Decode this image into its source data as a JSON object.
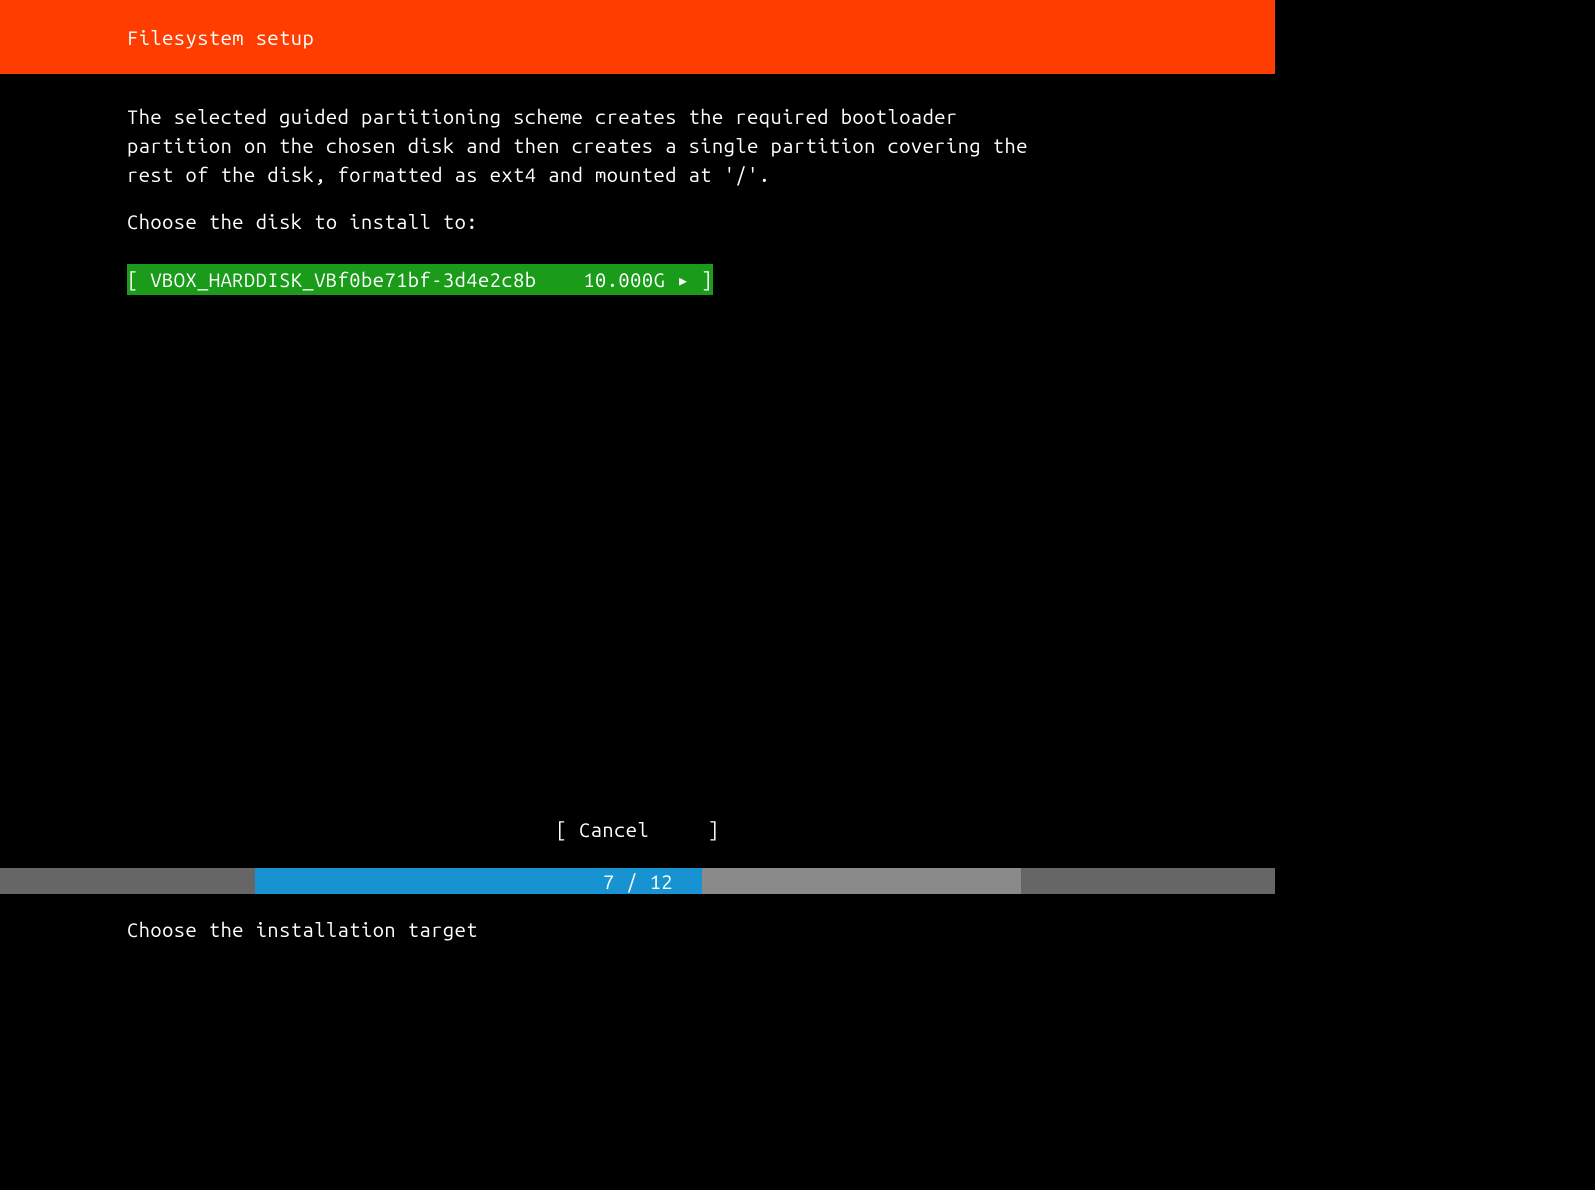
{
  "header": {
    "title": "Filesystem setup"
  },
  "main": {
    "description": "The selected guided partitioning scheme creates the required bootloader\npartition on the chosen disk and then creates a single partition covering the\nrest of the disk, formatted as ext4 and mounted at '/'.",
    "prompt": "Choose the disk to install to:",
    "disks": [
      {
        "name": "VBOX_HARDDISK_VBf0be71bf-3d4e2c8b",
        "size": "10.000G",
        "selected": true
      }
    ]
  },
  "actions": {
    "cancel_label": "Cancel"
  },
  "progress": {
    "current": 7,
    "total": 12,
    "label": "7 / 12",
    "percent": 58.3
  },
  "footer": {
    "hint": "Choose the installation target"
  }
}
